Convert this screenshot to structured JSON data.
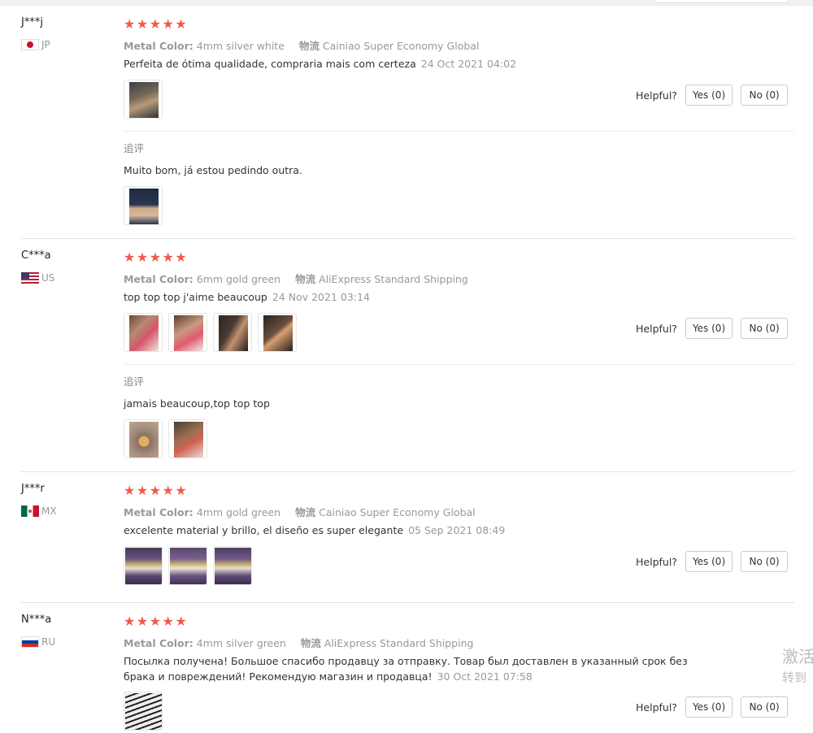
{
  "helpful_label": "Helpful?",
  "meta_keys": {
    "metal": "Metal Color:",
    "ship": "物流"
  },
  "followup_label": "追评",
  "watermark": {
    "line1": "激活",
    "line2": "转到"
  },
  "reviews": [
    {
      "name": "J***j",
      "country": "JP",
      "rating": 5,
      "metal": "4mm silver white",
      "ship": "Cainiao Super Economy Global",
      "text": "Perfeita de ótima qualidade, compraria mais com certeza",
      "date": "24 Oct 2021 04:02",
      "yes": "Yes (0)",
      "no": "No (0)",
      "followup": "Muito bom, já estou pedindo outra."
    },
    {
      "name": "C***a",
      "country": "US",
      "rating": 5,
      "metal": "6mm gold green",
      "ship": "AliExpress Standard Shipping",
      "text": "top top top j'aime beaucoup",
      "date": "24 Nov 2021 03:14",
      "yes": "Yes (0)",
      "no": "No (0)",
      "followup": "jamais beaucoup,top top top"
    },
    {
      "name": "J***r",
      "country": "MX",
      "rating": 5,
      "metal": "4mm gold green",
      "ship": "Cainiao Super Economy Global",
      "text": "excelente material y brillo, el diseño es super elegante",
      "date": "05 Sep 2021 08:49",
      "yes": "Yes (0)",
      "no": "No (0)"
    },
    {
      "name": "N***a",
      "country": "RU",
      "rating": 5,
      "metal": "4mm silver green",
      "ship": "AliExpress Standard Shipping",
      "text": "Посылка получена! Большое спасибо продавцу за отправку. Товар был доставлен в указанный срок без брака и повреждений! Рекомендую магазин и продавца!",
      "date": "30 Oct 2021 07:58",
      "yes": "Yes (0)",
      "no": "No (0)"
    }
  ]
}
